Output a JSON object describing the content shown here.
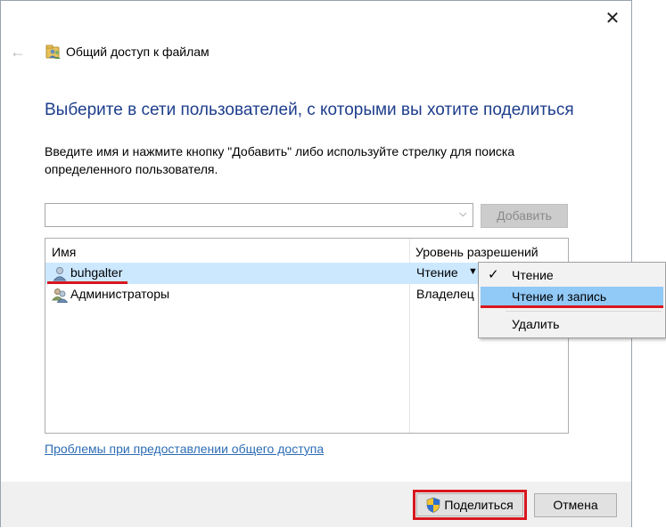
{
  "window": {
    "title": "Общий доступ к файлам",
    "close_glyph": "✕",
    "back_glyph": "←"
  },
  "heading": "Выберите в сети пользователей, с которыми вы хотите поделиться",
  "instructions": "Введите имя и нажмите кнопку \"Добавить\" либо используйте стрелку для поиска определенного пользователя.",
  "user_input": {
    "value": "",
    "arrow_glyph": "⌵"
  },
  "add_button": "Добавить",
  "list": {
    "headers": {
      "name": "Имя",
      "permission": "Уровень разрешений"
    },
    "rows": [
      {
        "name": "buhgalter",
        "permission": "Чтение",
        "selected": true,
        "has_dropdown": true
      },
      {
        "name": "Администраторы",
        "permission": "Владелец",
        "selected": false,
        "has_dropdown": false
      }
    ],
    "dropdown_glyph": "▼"
  },
  "permission_menu": {
    "check_glyph": "✓",
    "items": [
      {
        "label": "Чтение",
        "checked": true
      },
      {
        "label": "Чтение и запись",
        "checked": false,
        "highlighted": true
      },
      {
        "label": "Удалить",
        "checked": false
      }
    ]
  },
  "problems_link": "Проблемы при предоставлении общего доступа",
  "share_button": "Поделиться",
  "cancel_button": "Отмена",
  "icons": {
    "title": "shared-folder-users-icon",
    "user": "user-icon",
    "group": "user-group-icon",
    "shield": "uac-shield-icon"
  },
  "colors": {
    "heading": "#1e3e8c",
    "link": "#2d6db5",
    "selection": "#cce8ff",
    "menu_highlight": "#91c9f7",
    "annotation_red": "#d8171f"
  }
}
